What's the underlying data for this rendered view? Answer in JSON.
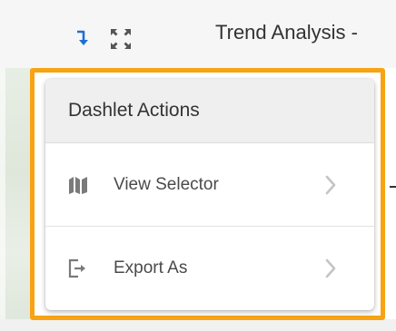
{
  "header": {
    "title": "Trend Analysis -"
  },
  "menu": {
    "title": "Dashlet Actions",
    "items": [
      {
        "label": "View Selector",
        "icon": "map-icon",
        "has_submenu": true
      },
      {
        "label": "Export As",
        "icon": "export-icon",
        "has_submenu": true
      }
    ]
  },
  "colors": {
    "highlight": "#f7a314",
    "accent_blue": "#1f6fd1",
    "icon_gray": "#7a7a7a"
  }
}
